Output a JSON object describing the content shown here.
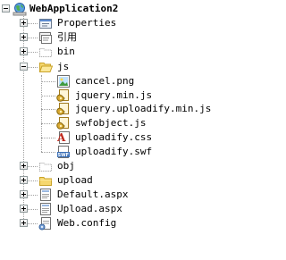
{
  "tree": {
    "root": {
      "label": "WebApplication2",
      "icon": "web-project-icon",
      "expanded": true
    },
    "items": [
      {
        "label": "Properties",
        "icon": "properties-icon",
        "expandable": true,
        "expanded": false
      },
      {
        "label": "引用",
        "icon": "references-icon",
        "expandable": true,
        "expanded": false
      },
      {
        "label": "bin",
        "icon": "folder-hidden-icon",
        "expandable": true,
        "expanded": false
      },
      {
        "label": "js",
        "icon": "folder-open-icon",
        "expandable": true,
        "expanded": true,
        "children": [
          {
            "label": "cancel.png",
            "icon": "image-file-icon"
          },
          {
            "label": "jquery.min.js",
            "icon": "script-file-icon"
          },
          {
            "label": "jquery.uploadify.min.js",
            "icon": "script-file-icon"
          },
          {
            "label": "swfobject.js",
            "icon": "script-file-icon"
          },
          {
            "label": "uploadify.css",
            "icon": "css-file-icon"
          },
          {
            "label": "uploadify.swf",
            "icon": "swf-file-icon"
          }
        ]
      },
      {
        "label": "obj",
        "icon": "folder-hidden-icon",
        "expandable": true,
        "expanded": false
      },
      {
        "label": "upload",
        "icon": "folder-icon",
        "expandable": true,
        "expanded": false
      },
      {
        "label": "Default.aspx",
        "icon": "aspx-file-icon",
        "expandable": true,
        "expanded": false
      },
      {
        "label": "Upload.aspx",
        "icon": "aspx-file-icon",
        "expandable": true,
        "expanded": false
      },
      {
        "label": "Web.config",
        "icon": "config-file-icon",
        "expandable": true,
        "expanded": false
      }
    ]
  },
  "colors": {
    "folder": "#f5d76e",
    "folder_edge": "#c9a227",
    "tree_line": "#a0a0a0",
    "script_gold": "#d8a830",
    "css_red": "#c0281c",
    "swf_blue": "#3a6fb6"
  }
}
